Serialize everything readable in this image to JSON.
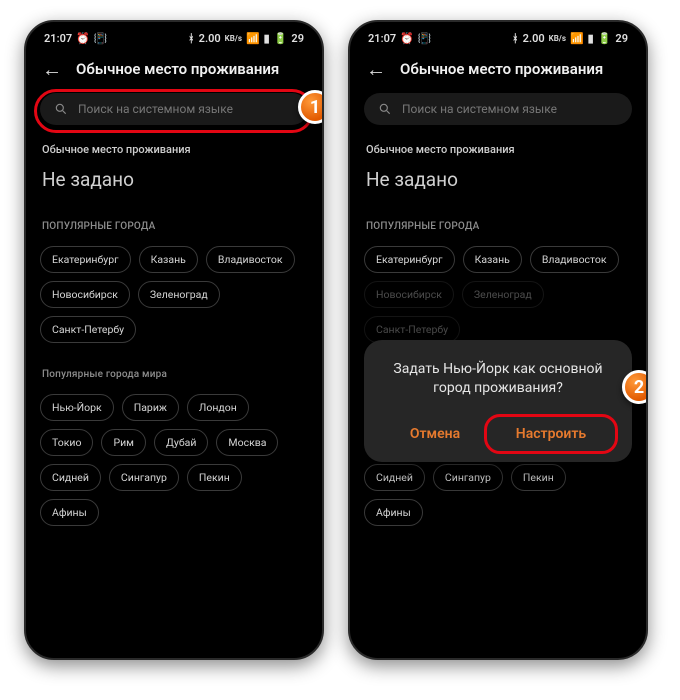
{
  "status": {
    "time": "21:07",
    "net": "2.00",
    "netUnit": "KB/s",
    "battery": "29"
  },
  "header": {
    "title": "Обычное место проживания"
  },
  "search": {
    "placeholder": "Поиск на системном языке"
  },
  "resSection": {
    "label": "Обычное место проживания",
    "value": "Не задано"
  },
  "popLocal": {
    "label": "ПОПУЛЯРНЫЕ ГОРОДА",
    "items": [
      "Екатеринбург",
      "Казань",
      "Владивосток",
      "Новосибирск",
      "Зеленоград",
      "Санкт-Петербу"
    ]
  },
  "popWorld": {
    "label": "Популярные города мира",
    "items": [
      "Нью-Йорк",
      "Париж",
      "Лондон",
      "Токио",
      "Рим",
      "Дубай",
      "Москва",
      "Сидней",
      "Сингапур",
      "Пекин",
      "Афины"
    ]
  },
  "dialog": {
    "text": "Задать Нью-Йорк как основной город проживания?",
    "cancel": "Отмена",
    "confirm": "Настроить"
  },
  "callouts": {
    "one": "1",
    "two": "2"
  }
}
